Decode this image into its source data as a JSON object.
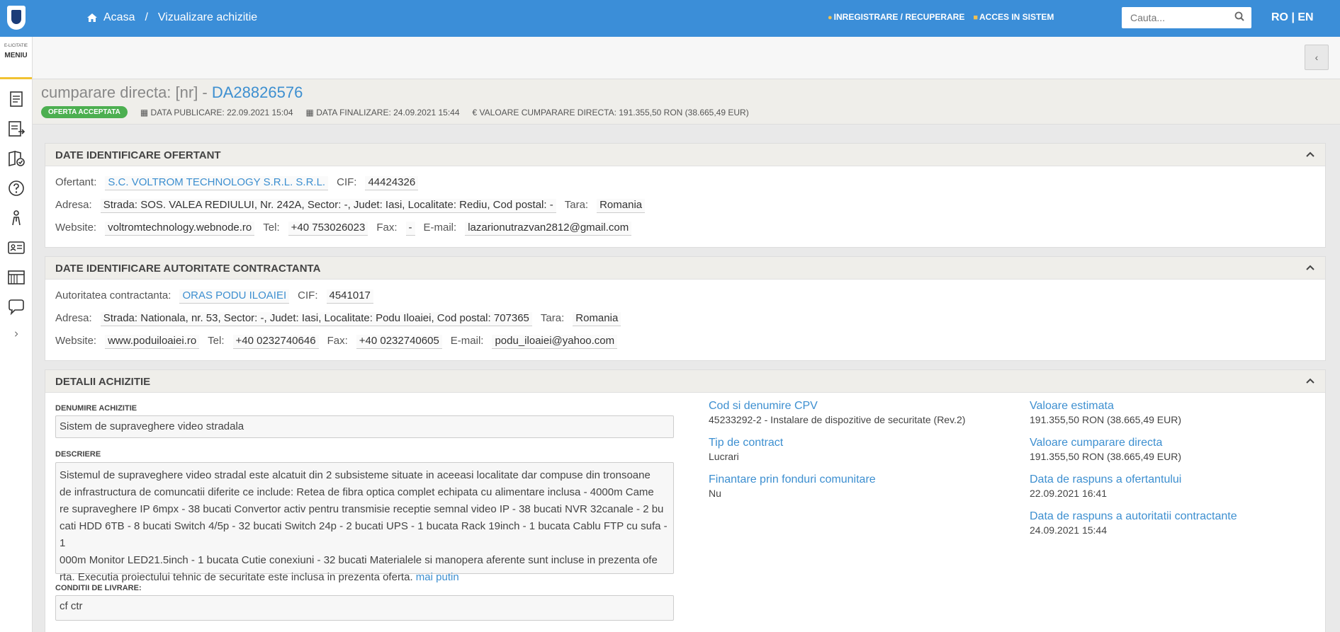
{
  "header": {
    "breadcrumb_home": "Acasa",
    "breadcrumb_sep": "/",
    "breadcrumb_current": "Vizualizare achizitie",
    "register_link": "INREGISTRARE / RECUPERARE",
    "login_link": "ACCES IN SISTEM",
    "search_placeholder": "Cauta...",
    "lang": "RO | EN"
  },
  "sidebar": {
    "small_text": "E-LICITATIE",
    "menu_label": "MENIU",
    "icons": [
      "document-icon",
      "list-export-icon",
      "book-check-icon",
      "help-icon",
      "person-icon",
      "id-card-icon",
      "archive-icon",
      "chat-icon",
      "chevron-right-icon"
    ]
  },
  "title": {
    "prefix": "cumparare directa: [nr] - ",
    "number": "DA28826576",
    "status": "OFERTA ACCEPTATA",
    "published": "DATA PUBLICARE: 22.09.2021 15:04",
    "finalized": "DATA FINALIZARE: 24.09.2021 15:44",
    "value": "€ VALOARE CUMPARARE DIRECTA: 191.355,50  RON (38.665,49  EUR)"
  },
  "ofertant": {
    "heading": "DATE IDENTIFICARE OFERTANT",
    "ofertant_label": "Ofertant:",
    "ofertant": "S.C. VOLTROM TECHNOLOGY S.R.L. S.R.L.",
    "cif_label": "CIF:",
    "cif": "44424326",
    "adresa_label": "Adresa:",
    "adresa": "Strada: SOS. VALEA REDIULUI, Nr. 242A, Sector: -, Judet: Iasi, Localitate: Rediu, Cod postal: -",
    "tara_label": "Tara:",
    "tara": "Romania",
    "website_label": "Website:",
    "website": "voltromtechnology.webnode.ro",
    "tel_label": "Tel:",
    "tel": "+40 753026023",
    "fax_label": "Fax:",
    "fax": "-",
    "email_label": "E-mail:",
    "email": "lazarionutrazvan2812@gmail.com"
  },
  "autoritate": {
    "heading": "DATE IDENTIFICARE AUTORITATE CONTRACTANTA",
    "autoritate_label": "Autoritatea contractanta:",
    "autoritate": "ORAS PODU ILOAIEI",
    "cif_label": "CIF:",
    "cif": "4541017",
    "adresa_label": "Adresa:",
    "adresa": "Strada: Nationala, nr. 53, Sector: -, Judet: Iasi, Localitate: Podu Iloaiei, Cod postal: 707365",
    "tara_label": "Tara:",
    "tara": "Romania",
    "website_label": "Website:",
    "website": "www.poduiloaiei.ro",
    "tel_label": "Tel:",
    "tel": "+40 0232740646",
    "fax_label": "Fax:",
    "fax": "+40 0232740605",
    "email_label": "E-mail:",
    "email": "podu_iloaiei@yahoo.com"
  },
  "detalii": {
    "heading": "DETALII ACHIZITIE",
    "denumire_label": "DENUMIRE ACHIZITIE",
    "denumire": "Sistem de supraveghere video stradala",
    "descriere_label": "DESCRIERE",
    "descriere_lines": [
      "Sistemul de supraveghere video stradal este alcatuit din 2 subsisteme situate in aceeasi localitate dar compuse din tronsoane",
      "de infrastructura de comuncatii diferite ce include: Retea de fibra optica complet echipata cu alimentare inclusa - 4000m Came",
      "re supraveghere IP 6mpx - 38 bucati Convertor activ pentru transmisie receptie semnal video IP - 38 bucati NVR 32canale - 2 bu",
      "cati HDD 6TB - 8 bucati Switch 4/5p - 32 bucati Switch 24p - 2 bucati UPS - 1 bucata Rack 19inch - 1 bucata Cablu FTP cu sufa - 1",
      "000m Monitor LED21.5inch - 1 bucata Cutie conexiuni - 32 bucati Materialele si manopera aferente sunt incluse in prezenta ofe",
      "rta. Executia proiectului tehnic de securitate este inclusa in prezenta oferta."
    ],
    "more_link": "mai putin",
    "conditii_label": "CONDITII DE LIVRARE:",
    "conditii": "cf ctr",
    "cpv_label": "Cod si denumire CPV",
    "cpv": "45233292-2 - Instalare de dispozitive de securitate (Rev.2)",
    "tip_label": "Tip de contract",
    "tip": "Lucrari",
    "finantare_label": "Finantare prin fonduri comunitare",
    "finantare": "Nu",
    "val_est_label": "Valoare estimata",
    "val_est": "191.355,50  RON (38.665,49  EUR)",
    "val_cd_label": "Valoare cumparare directa",
    "val_cd": "191.355,50  RON (38.665,49  EUR)",
    "raspuns_of_label": "Data de raspuns a ofertantului",
    "raspuns_of": "22.09.2021 16:41",
    "raspuns_aut_label": "Data de raspuns a autoritatii contractante",
    "raspuns_aut": "24.09.2021 15:44"
  }
}
